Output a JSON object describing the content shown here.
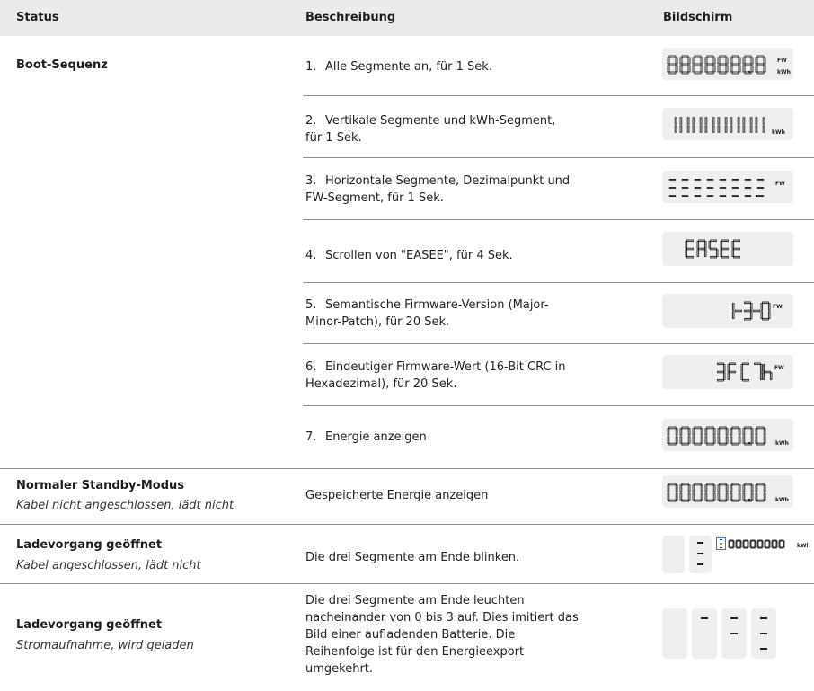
{
  "header": {
    "status": "Status",
    "description": "Beschreibung",
    "screen": "Bildschirm"
  },
  "boot": {
    "status_title": "Boot-Sequenz",
    "steps": [
      {
        "num": "1.",
        "text": "Alle Segmente an, für 1 Sek.",
        "display": "88888888",
        "suffix_top": "FW",
        "suffix_bottom": "kWh"
      },
      {
        "num": "2.",
        "text": "Vertikale Segmente und kWh-Segment, für 1 Sek.",
        "display": "vertical",
        "suffix_bottom": "kWh"
      },
      {
        "num": "3.",
        "text": "Horizontale Segmente, Dezimalpunkt und FW-Segment, für 1 Sek.",
        "display": "horizontal",
        "suffix_top": "FW"
      },
      {
        "num": "4.",
        "text": "Scrollen von \"EASEE\", für 4 Sek.",
        "display": "EASEE"
      },
      {
        "num": "5.",
        "text": "Semantische Firmware-Version (Major-Minor-Patch), für 20 Sek.",
        "display": "1-3-0",
        "suffix_top": "FW"
      },
      {
        "num": "6.",
        "text": "Eindeutiger Firmware-Wert (16-Bit CRC in Hexadezimal), für 20 Sek.",
        "display": "3FC7h",
        "suffix_top": "FW"
      },
      {
        "num": "7.",
        "text": "Energie anzeigen",
        "display": "00000000",
        "suffix_bottom": "kWh"
      }
    ]
  },
  "standby": {
    "status_title": "Normaler Standby-Modus",
    "status_sub": "Kabel nicht angeschlossen, lädt nicht",
    "text": "Gespeicherte Energie anzeigen",
    "display": "00000000",
    "suffix_bottom": "kWh"
  },
  "open": {
    "status_title": "Ladevorgang geöffnet",
    "status_sub": "Kabel angeschlossen, lädt nicht",
    "text": "Die drei Segmente am Ende blinken.",
    "mini_display": "00000000",
    "mini_suffix": "kWh"
  },
  "charging": {
    "status_title": "Ladevorgang geöffnet",
    "status_sub": "Stromaufnahme, wird geladen",
    "text": "Die drei Segmente am Ende leuchten nacheinander von 0 bis 3 auf. Dies imitiert das Bild einer aufladenden Batterie. Die Reihenfolge ist für den Energieexport umgekehrt."
  },
  "colors": {
    "header_bg": "#ebebeb",
    "lcd_bg": "#efefef",
    "lcd_segment": "#1f1f1f",
    "highlight": "#3a78d6"
  }
}
